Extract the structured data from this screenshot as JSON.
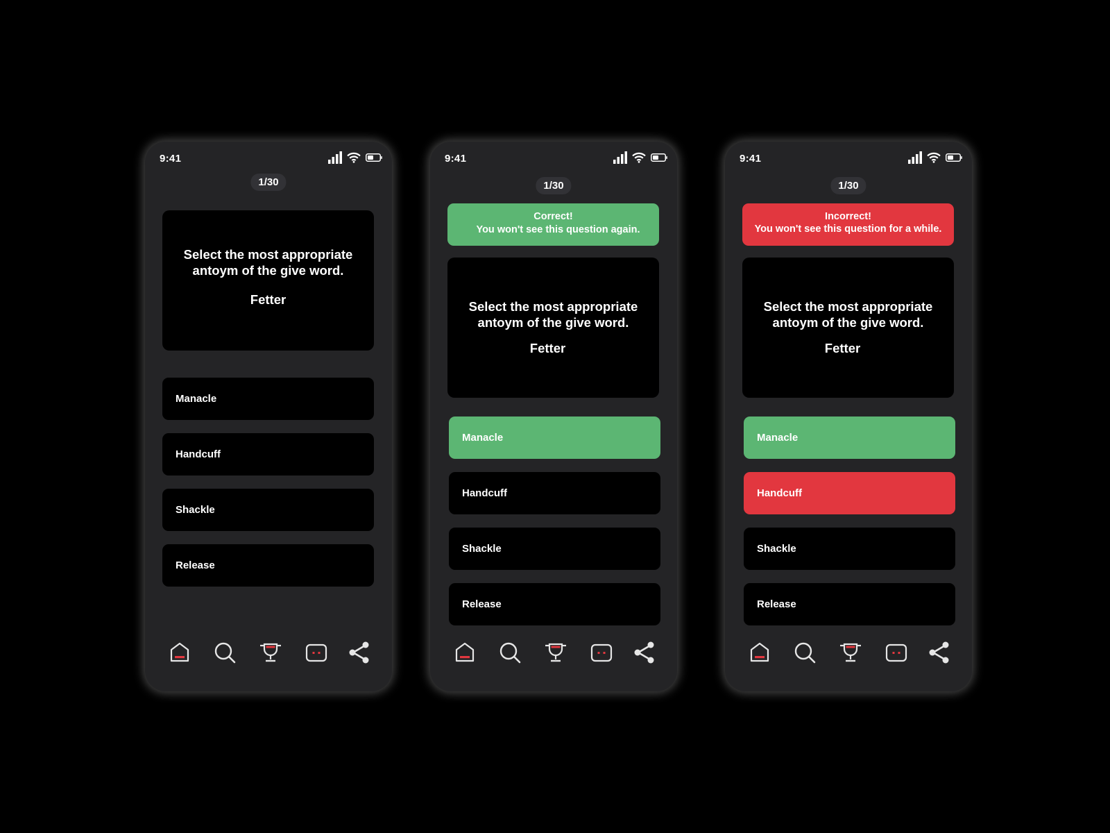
{
  "status_bar": {
    "time": "9:41"
  },
  "icons": {
    "signal": "cellular-signal-icon",
    "wifi": "wifi-icon",
    "battery": "battery-icon",
    "tabs": [
      "home-icon",
      "search-icon",
      "trophy-icon",
      "chat-icon",
      "share-icon"
    ]
  },
  "colors": {
    "background": "#000000",
    "phone": "#242426",
    "card": "#000000",
    "correct": "#5cb673",
    "incorrect": "#e2373f",
    "icon_accent": "#e2373f",
    "icon_stroke": "#e6e6e6"
  },
  "screens": [
    {
      "state": "unanswered",
      "counter": "1/30",
      "question": {
        "text": "Select the most appropriate antoym of the give word.",
        "word": "Fetter"
      },
      "options": [
        {
          "label": "Manacle",
          "state": "default"
        },
        {
          "label": "Handcuff",
          "state": "default"
        },
        {
          "label": "Shackle",
          "state": "default"
        },
        {
          "label": "Release",
          "state": "default"
        }
      ]
    },
    {
      "state": "correct",
      "counter": "1/30",
      "banner": {
        "title": "Correct!",
        "message": "You won't see this question again."
      },
      "question": {
        "text": "Select the most appropriate antoym of the give word.",
        "word": "Fetter"
      },
      "options": [
        {
          "label": "Manacle",
          "state": "correct"
        },
        {
          "label": "Handcuff",
          "state": "default"
        },
        {
          "label": "Shackle",
          "state": "default"
        },
        {
          "label": "Release",
          "state": "default"
        }
      ]
    },
    {
      "state": "incorrect",
      "counter": "1/30",
      "banner": {
        "title": "Incorrect!",
        "message": "You won't see this question for a while."
      },
      "question": {
        "text": "Select the most appropriate antoym of the give word.",
        "word": "Fetter"
      },
      "options": [
        {
          "label": "Manacle",
          "state": "correct"
        },
        {
          "label": "Handcuff",
          "state": "wrong"
        },
        {
          "label": "Shackle",
          "state": "default"
        },
        {
          "label": "Release",
          "state": "default"
        }
      ]
    }
  ]
}
